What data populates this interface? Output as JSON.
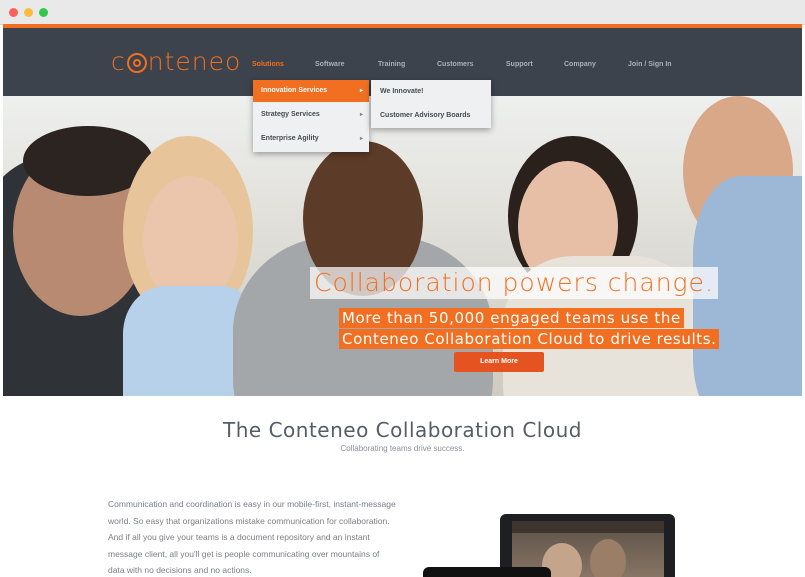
{
  "nav": {
    "logo_text": "conteneo",
    "items": [
      {
        "label": "Solutions",
        "active": true
      },
      {
        "label": "Software"
      },
      {
        "label": "Training"
      },
      {
        "label": "Customers"
      },
      {
        "label": "Support"
      },
      {
        "label": "Company"
      },
      {
        "label": "Join / Sign In"
      }
    ]
  },
  "dropdown": {
    "items": [
      {
        "label": "Innovation Services",
        "highlighted": true
      },
      {
        "label": "Strategy Services"
      },
      {
        "label": "Enterprise Agility"
      }
    ],
    "submenu": [
      {
        "label": "We Innovate!"
      },
      {
        "label": "Customer Advisory Boards"
      }
    ]
  },
  "hero": {
    "headline": "Collaboration powers change.",
    "subline_1": "More than 50,000 engaged teams use the",
    "subline_2": "Conteneo Collaboration Cloud to drive results.",
    "cta_label": "Learn More"
  },
  "section": {
    "title": "The Conteneo Collaboration Cloud",
    "subtitle": "Collaborating teams drive success.",
    "body": "Communication and coordination is easy in our mobile-first, instant-message world. So easy that organizations mistake communication for collaboration. And if all you give your teams is a document repository and an instant message client, all you'll get is people communicating over mountains of data with no decisions and no actions."
  },
  "colors": {
    "accent": "#f26f21",
    "nav_bg": "#3c434c"
  }
}
